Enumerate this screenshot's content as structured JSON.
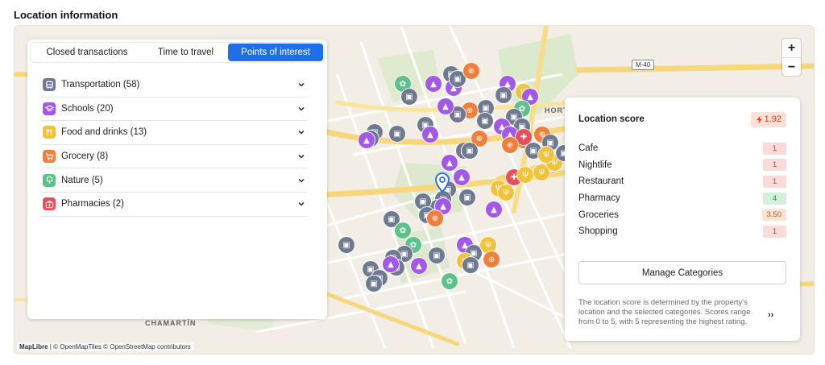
{
  "section_title": "Location information",
  "tabs": [
    {
      "label": "Closed transactions",
      "active": false
    },
    {
      "label": "Time to travel",
      "active": false
    },
    {
      "label": "Points of interest",
      "active": true
    }
  ],
  "poi_categories": [
    {
      "label": "Transportation (58)",
      "icon": "bus-icon",
      "color": "#6f7a91"
    },
    {
      "label": "Schools (20)",
      "icon": "graduation-cap-icon",
      "color": "#a259e6"
    },
    {
      "label": "Food and drinks (13)",
      "icon": "fork-knife-icon",
      "color": "#f2c23a"
    },
    {
      "label": "Grocery (8)",
      "icon": "shopping-cart-icon",
      "color": "#ef7f3a"
    },
    {
      "label": "Nature (5)",
      "icon": "tree-icon",
      "color": "#5cc28a"
    },
    {
      "label": "Pharmacies (2)",
      "icon": "medical-bag-icon",
      "color": "#e5505a"
    }
  ],
  "map": {
    "labels": {
      "hortaleza": "HORT",
      "chamartin": "CHAMARTÍN",
      "road": "M-40"
    },
    "attribution_brand": "MapLibre",
    "attribution_text": " | © OpenMapTiles © OpenStreetMap contributors",
    "zoom_in": "+",
    "zoom_out": "−"
  },
  "score": {
    "title": "Location score",
    "value": "1.92",
    "rows": [
      {
        "label": "Cafe",
        "value": "1",
        "tone": "red"
      },
      {
        "label": "Nightlife",
        "value": "1",
        "tone": "red"
      },
      {
        "label": "Restaurant",
        "value": "1",
        "tone": "red"
      },
      {
        "label": "Pharmacy",
        "value": "4",
        "tone": "green"
      },
      {
        "label": "Groceries",
        "value": "3.50",
        "tone": "orange"
      },
      {
        "label": "Shopping",
        "value": "1",
        "tone": "red"
      }
    ],
    "manage_label": "Manage Categories",
    "note": "The location score is determined by the property's location and the selected categories. Scores range from 0 to 5, with 5 representing the highest rating.",
    "more_label": "››"
  }
}
